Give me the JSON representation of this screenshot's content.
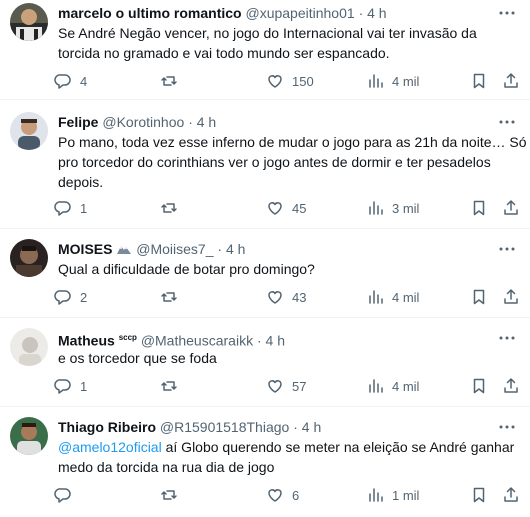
{
  "tweets": [
    {
      "name": "marcelo o ultimo romantico",
      "badge": "",
      "handle": "@xupapeitinho01",
      "separator": "·",
      "time": "4 h",
      "mention": "",
      "text": "Se André Negão vencer, no jogo do Internacional vai ter invasão da torcida no gramado e vai todo mundo ser espancado.",
      "replies": "4",
      "retweets": "",
      "likes": "150",
      "views": "4 mil"
    },
    {
      "name": "Felipe",
      "badge": "",
      "handle": "@Korotinhoo",
      "separator": "·",
      "time": "4 h",
      "mention": "",
      "text": "Po mano, toda vez esse inferno de mudar o jogo para as 21h da noite… Só pro torcedor do corinthians ver o jogo antes de dormir e ter pesadelos depois.",
      "replies": "1",
      "retweets": "",
      "likes": "45",
      "views": "3 mil"
    },
    {
      "name": "MOISES",
      "badge": "",
      "handle": "@Moiises7_",
      "separator": "·",
      "time": "4 h",
      "mention": "",
      "text": "Qual a dificuldade de botar pro domingo?",
      "replies": "2",
      "retweets": "",
      "likes": "43",
      "views": "4 mil"
    },
    {
      "name": "Matheus",
      "badge": "sccp",
      "handle": "@Matheuscaraikk",
      "separator": "·",
      "time": "4 h",
      "mention": "",
      "text": "e os torcedor que se foda",
      "replies": "1",
      "retweets": "",
      "likes": "57",
      "views": "4 mil"
    },
    {
      "name": "Thiago Ribeiro",
      "badge": "",
      "handle": "@R15901518Thiago",
      "separator": "·",
      "time": "4 h",
      "mention": "@amelo12oficial",
      "text": " aí Globo querendo se meter na eleição  se André ganhar medo da torcida na rua dia de jogo",
      "replies": "",
      "retweets": "",
      "likes": "6",
      "views": "1 mil"
    }
  ],
  "icons": {
    "reply": "speech-bubble",
    "retweet": "retweet-arrows",
    "like": "heart",
    "views": "bar-chart",
    "bookmark": "bookmark",
    "share": "share-arrow-up",
    "more": "ellipsis"
  },
  "colors": {
    "text": "#0f1419",
    "secondary": "#536471",
    "mention": "#1d9bf0",
    "divider": "#eff3f4"
  }
}
